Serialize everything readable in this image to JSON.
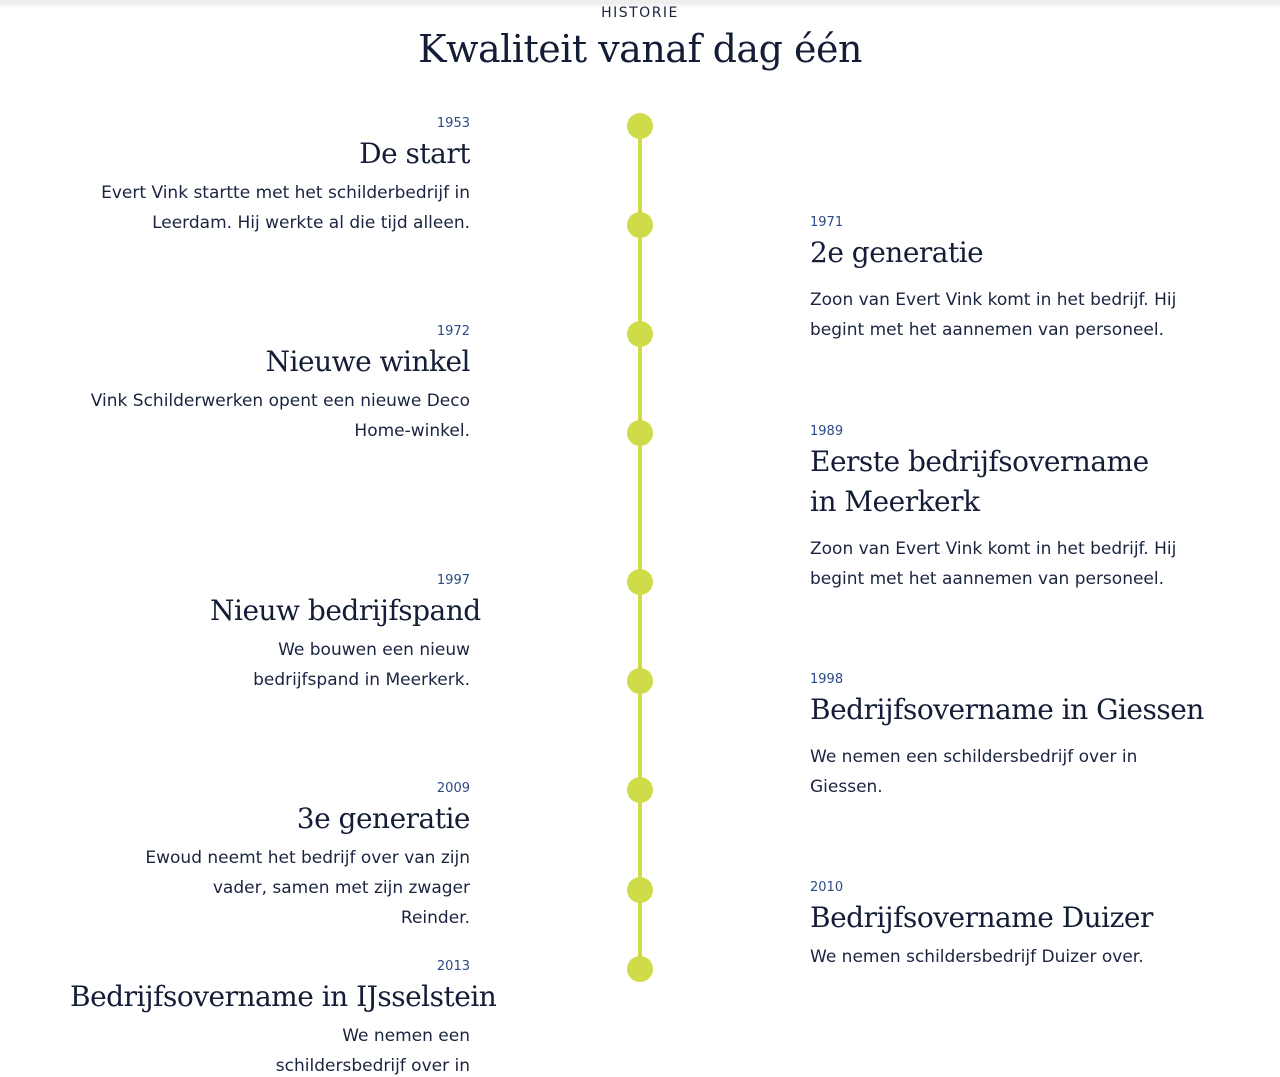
{
  "section": {
    "eyebrow": "HISTORIE",
    "heading": "Kwaliteit vanaf dag één"
  },
  "timeline": {
    "line_color": "#cfdc4a",
    "entries": [
      {
        "year": "1953",
        "title": "De start",
        "desc": "Evert Vink startte met het schilderbedrijf in Leerdam. Hij werkte al die tijd alleen.",
        "side": "left"
      },
      {
        "year": "1971",
        "title": "2e generatie",
        "desc": "Zoon van Evert Vink komt in het bedrijf. Hij begint met het aannemen van personeel.",
        "side": "right"
      },
      {
        "year": "1972",
        "title": "Nieuwe winkel",
        "desc": "Vink Schilderwerken opent een nieuwe Deco Home-winkel.",
        "side": "left"
      },
      {
        "year": "1989",
        "title": "Eerste bedrijfsovername in Meerkerk",
        "desc": "Zoon van Evert Vink komt in het bedrijf. Hij begint met het aannemen van personeel.",
        "side": "right"
      },
      {
        "year": "1997",
        "title": "Nieuw bedrijfspand",
        "desc": "We bouwen een nieuw bedrijfspand in Meerkerk.",
        "side": "left"
      },
      {
        "year": "1998",
        "title": "Bedrijfsovername in Giessen",
        "desc": "We nemen een schildersbedrijf over in Giessen.",
        "side": "right"
      },
      {
        "year": "2009",
        "title": "3e generatie",
        "desc": "Ewoud neemt het bedrijf over van zijn vader, samen met zijn zwager Reinder.",
        "side": "left"
      },
      {
        "year": "2010",
        "title": "Bedrijfsovername Duizer",
        "desc": "We nemen schildersbedrijf Duizer over.",
        "side": "right"
      },
      {
        "year": "2013",
        "title": "Bedrijfsovername in IJsselstein",
        "desc": "We nemen een schildersbedrijf over in IJsselstein.",
        "side": "left"
      }
    ]
  }
}
